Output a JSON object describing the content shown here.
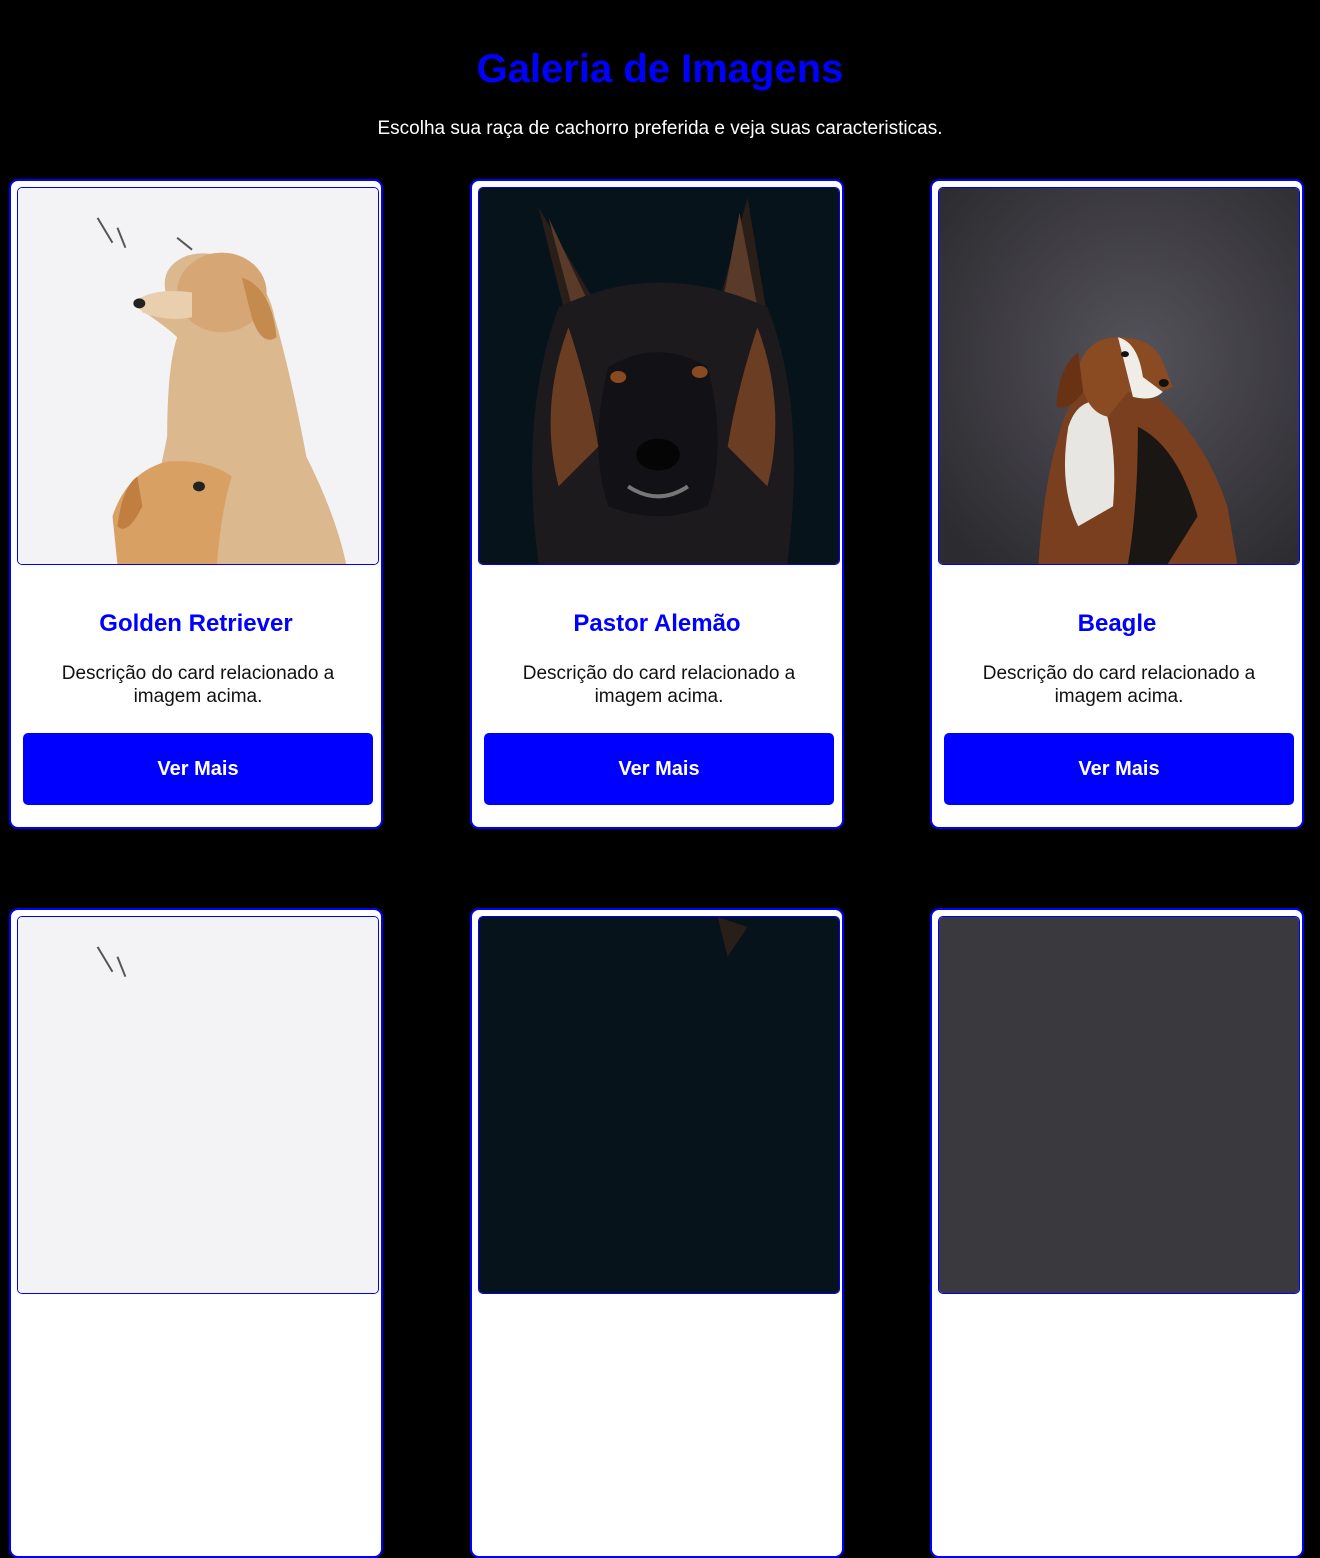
{
  "header": {
    "title": "Galeria de Imagens",
    "subtitle": "Escolha sua raça de cachorro preferida e veja suas caracteristicas."
  },
  "cards": [
    {
      "title": "Golden Retriever",
      "description": "Descrição do card relacionado a imagem acima.",
      "button_label": "Ver Mais",
      "image": "golden-retriever-photo"
    },
    {
      "title": "Pastor Alemão",
      "description": "Descrição do card relacionado a imagem acima.",
      "button_label": "Ver Mais",
      "image": "german-shepherd-photo"
    },
    {
      "title": "Beagle",
      "description": "Descrição do card relacionado a imagem acima.",
      "button_label": "Ver Mais",
      "image": "beagle-photo"
    },
    {
      "image": "golden-retriever-photo"
    },
    {
      "image": "german-shepherd-photo"
    },
    {
      "image": "beagle-photo"
    }
  ],
  "colors": {
    "background": "#000000",
    "accent": "#0000ff",
    "card_background": "#ffffff"
  }
}
